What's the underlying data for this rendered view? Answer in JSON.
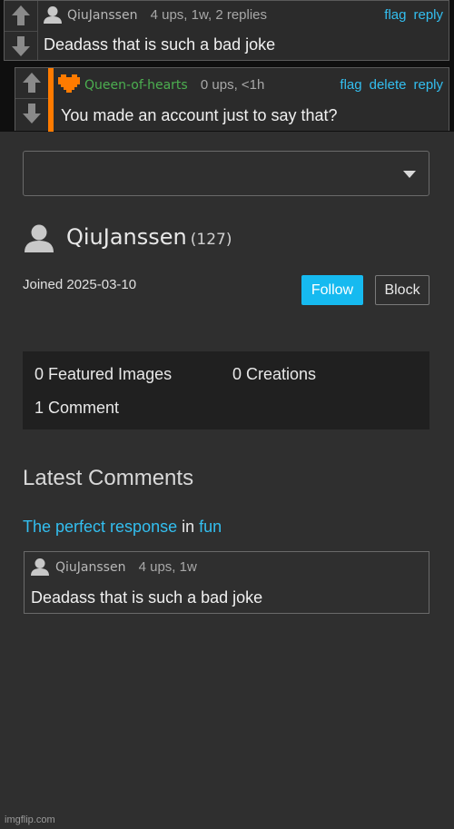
{
  "thread": {
    "comment1": {
      "username": "QiuJanssen",
      "meta": "4 ups, 1w, 2 replies",
      "links": [
        "flag",
        "reply"
      ],
      "text": "Deadass that is such a bad joke"
    },
    "comment2": {
      "username": "Queen-of-hearts",
      "meta": "0 ups, <1h",
      "links": [
        "flag",
        "delete",
        "reply"
      ],
      "text": "You made an account just to say that?"
    }
  },
  "profile": {
    "dropdown_value": "",
    "username": "QiuJanssen",
    "score": "(127)",
    "joined": "Joined 2025-03-10",
    "follow_label": "Follow",
    "block_label": "Block",
    "stats": {
      "featured": "0 Featured Images",
      "creations": "0 Creations",
      "comments": "1 Comment"
    }
  },
  "latest": {
    "heading": "Latest Comments",
    "post_title": "The perfect response",
    "in_word": "in",
    "stream": "fun",
    "comment": {
      "username": "QiuJanssen",
      "meta": "4 ups, 1w",
      "text": "Deadass that is such a bad joke"
    }
  },
  "watermark": "imgflip.com",
  "colors": {
    "accent": "#33bff0",
    "follow_button": "#16baf0",
    "mod_badge": "#ff7b00",
    "mod_name": "#4caf50",
    "panel_bg": "#2f2f2f",
    "top_bg": "#0f0f0f"
  }
}
